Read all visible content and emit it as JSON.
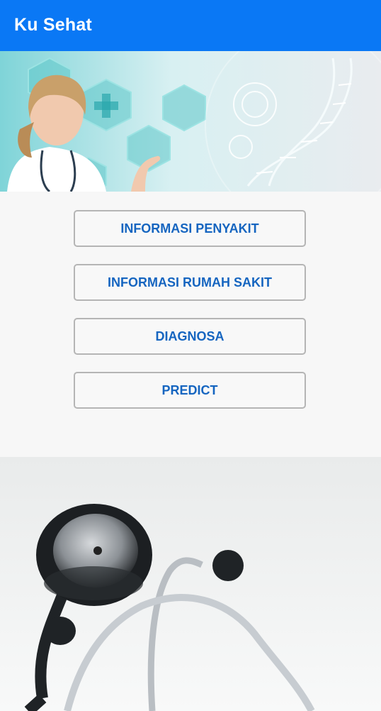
{
  "appbar": {
    "title": "Ku Sehat"
  },
  "banner": {
    "image": "doctor-dna-banner"
  },
  "menu": {
    "items": [
      {
        "label": "INFORMASI PENYAKIT"
      },
      {
        "label": "INFORMASI RUMAH SAKIT"
      },
      {
        "label": "DIAGNOSA"
      },
      {
        "label": "PREDICT"
      }
    ]
  },
  "footer": {
    "image": "stethoscope-photo"
  },
  "colors": {
    "appbar": "#0a78f5",
    "button_text": "#1565c0",
    "button_border": "#b5b5b5",
    "background": "#f7f7f7"
  }
}
